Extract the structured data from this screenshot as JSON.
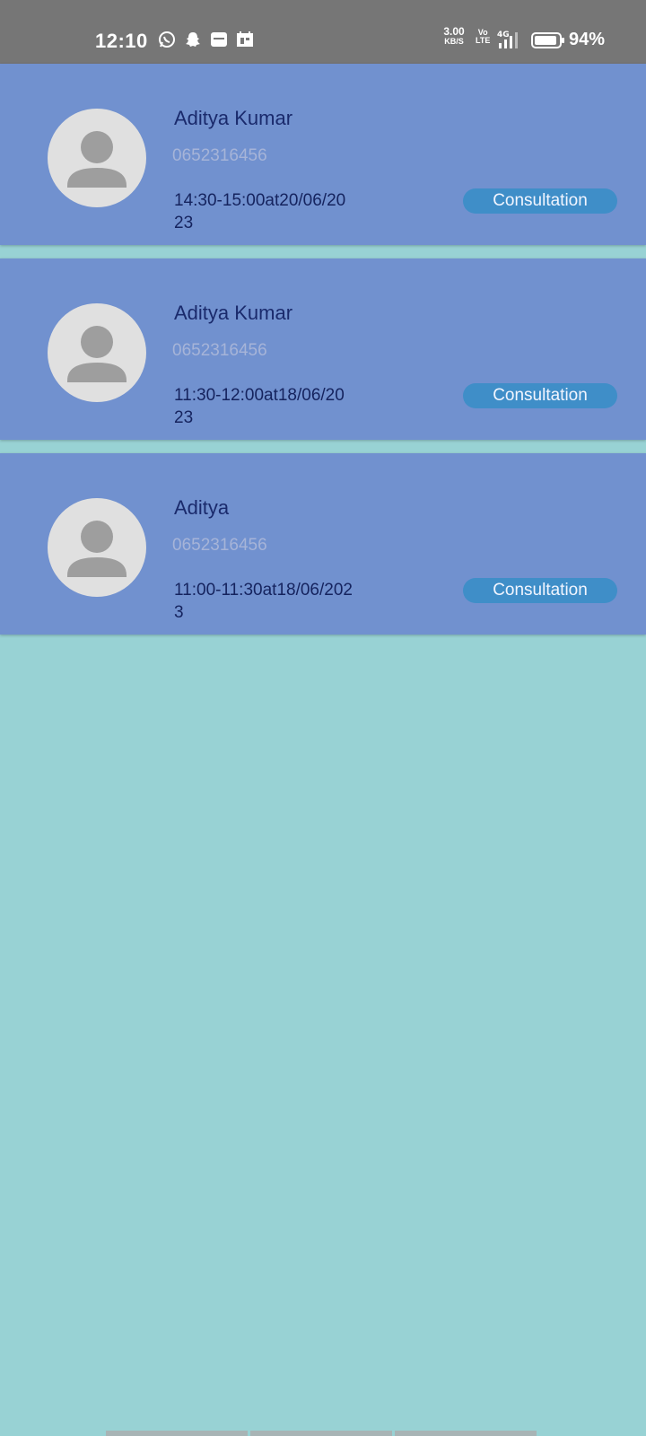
{
  "status_bar": {
    "time": "12:10",
    "apps": [
      "whatsapp-icon",
      "snapchat-icon",
      "news-app-icon",
      "calendar-app-icon"
    ],
    "speed_value": "3.00",
    "speed_unit": "KB/S",
    "volte_top": "Vo",
    "volte_bottom": "LTE",
    "network": "4G",
    "battery_level": 0.94,
    "battery_text": "94%"
  },
  "appointments": [
    {
      "name": "Aditya Kumar",
      "phone": "0652316456",
      "slot": "14:30-15:00at20/06/2023",
      "type": "Consultation"
    },
    {
      "name": "Aditya Kumar",
      "phone": "0652316456",
      "slot": "11:30-12:00at18/06/2023",
      "type": "Consultation"
    },
    {
      "name": "Aditya",
      "phone": "0652316456",
      "slot": "11:00-11:30at18/06/2023",
      "type": "Consultation"
    }
  ],
  "colors": {
    "background": "#98d2d4",
    "card": "#7191cf",
    "tag": "#3f8ec8",
    "name_text": "#1a2a6c",
    "phone_text": "#a6b4d8",
    "status_bar": "#767676"
  }
}
